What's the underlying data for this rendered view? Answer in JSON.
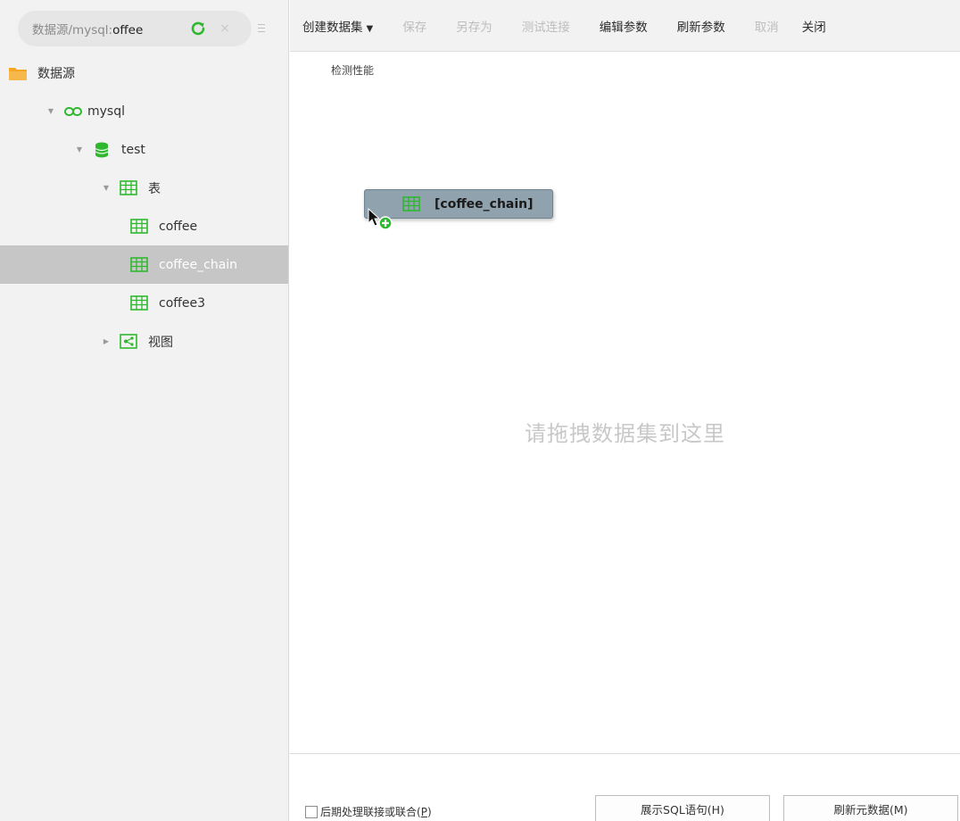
{
  "source_bar": {
    "label_prefix": "数据源/mysql:",
    "label_name": "offee"
  },
  "tree": {
    "root": {
      "label": "数据源",
      "icon": "folder-icon"
    },
    "connection": {
      "label": "mysql",
      "icon": "link-icon"
    },
    "database": {
      "label": "test",
      "icon": "database-icon"
    },
    "tables_group": {
      "label": "表",
      "icon": "table-icon"
    },
    "tables": [
      {
        "label": "coffee",
        "icon": "table-icon",
        "selected": false
      },
      {
        "label": "coffee_chain",
        "icon": "table-icon",
        "selected": true
      },
      {
        "label": "coffee3",
        "icon": "table-icon",
        "selected": false
      }
    ],
    "views_group": {
      "label": "视图",
      "icon": "view-icon"
    }
  },
  "toolbar": {
    "create_dataset": "创建数据集",
    "save": "保存",
    "save_as": "另存为",
    "test_connection": "测试连接",
    "edit_params": "编辑参数",
    "refresh_params": "刷新参数",
    "cancel": "取消",
    "close": "关闭"
  },
  "canvas": {
    "perf_check": "检测性能",
    "drag_item_label": "[coffee_chain]",
    "drop_hint": "请拖拽数据集到这里"
  },
  "footer": {
    "union_label": "后期处理联接或联合",
    "union_shortcut": "P",
    "show_sql": "展示SQL语句(H)",
    "refresh_meta": "刷新元数据(M)"
  },
  "colors": {
    "icon_green": "#2eb82e",
    "folder_orange": "#f5a623",
    "selected_row": "#c6c6c6",
    "drag_node_bg": "#8fa2ad"
  }
}
